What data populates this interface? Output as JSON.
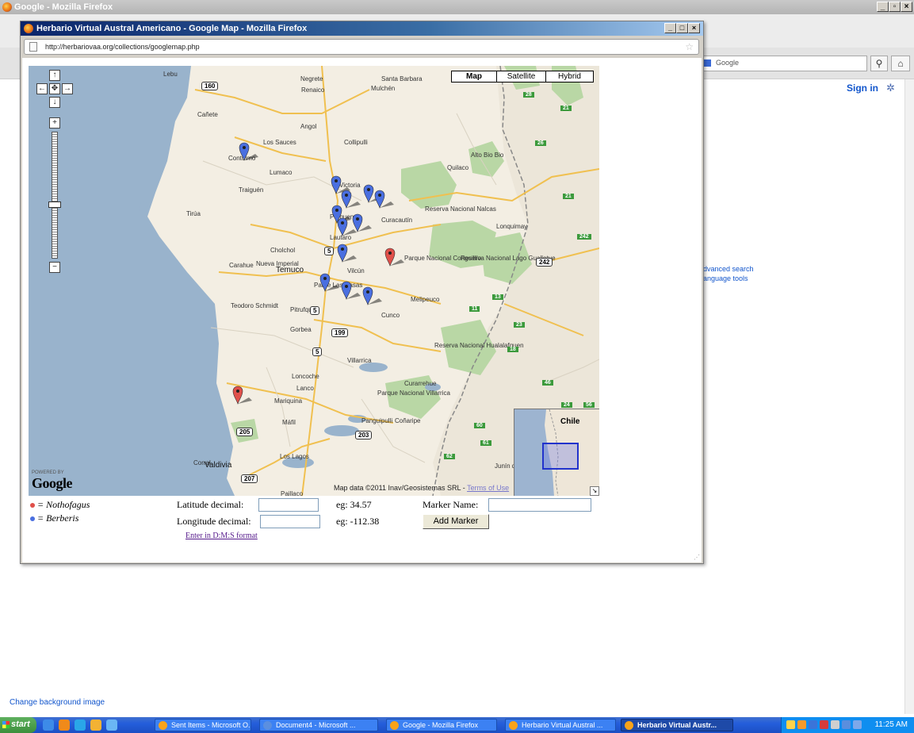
{
  "background_window": {
    "title": "Google - Mozilla Firefox",
    "search_placeholder": "Google",
    "sign_in": "Sign in",
    "links": [
      "dvanced search",
      "anguage tools"
    ],
    "change_background": "Change background image"
  },
  "popup": {
    "title": "Herbario Virtual Austral Americano - Google Map - Mozilla Firefox",
    "url": "http://herbariovaa.org/collections/googlemap.php"
  },
  "map": {
    "map_types": [
      "Map",
      "Satellite",
      "Hybrid"
    ],
    "selected_type": "Map",
    "powered_by": "POWERED BY",
    "google_logo": "Google",
    "attribution": "Map data ©2011 Inav/Geosistemas SRL -",
    "terms_link": "Terms of Use",
    "overview_label": "Chile",
    "place_labels": [
      {
        "text": "Lebu",
        "cls": "lbl"
      },
      {
        "text": "Negrete",
        "cls": "lbl"
      },
      {
        "text": "Renaico",
        "cls": "lbl"
      },
      {
        "text": "Santa Barbara",
        "cls": "lbl"
      },
      {
        "text": "Mulchén",
        "cls": "lbl"
      },
      {
        "text": "Cañete",
        "cls": "lbl"
      },
      {
        "text": "Angol",
        "cls": "lbl"
      },
      {
        "text": "Los Sauces",
        "cls": "lbl"
      },
      {
        "text": "Collipulli",
        "cls": "lbl"
      },
      {
        "text": "Contulmo",
        "cls": "lbl"
      },
      {
        "text": "Alto Bio Bio",
        "cls": "lbl"
      },
      {
        "text": "Lumaco",
        "cls": "lbl"
      },
      {
        "text": "Quilaco",
        "cls": "lbl"
      },
      {
        "text": "Traiguén",
        "cls": "lbl"
      },
      {
        "text": "Victoria",
        "cls": "lbl"
      },
      {
        "text": "Tirúa",
        "cls": "lbl"
      },
      {
        "text": "Reserva Nacional Nalcas",
        "cls": "lbl"
      },
      {
        "text": "Curacautín",
        "cls": "lbl"
      },
      {
        "text": "Perquenco",
        "cls": "lbl"
      },
      {
        "text": "Lonquimay",
        "cls": "lbl"
      },
      {
        "text": "Lautaro",
        "cls": "lbl"
      },
      {
        "text": "Cholchol",
        "cls": "lbl"
      },
      {
        "text": "Parque Nacional Conguillío",
        "cls": "lbl"
      },
      {
        "text": "Reserva Nacional Lago Gualletue",
        "cls": "lbl"
      },
      {
        "text": "Carahue",
        "cls": "lbl"
      },
      {
        "text": "Nueva Imperial",
        "cls": "lbl"
      },
      {
        "text": "Temuco",
        "cls": "lbl city"
      },
      {
        "text": "Vilcún",
        "cls": "lbl"
      },
      {
        "text": "Padre Las Casas",
        "cls": "lbl"
      },
      {
        "text": "Melipeuco",
        "cls": "lbl"
      },
      {
        "text": "Teodoro Schmidt",
        "cls": "lbl"
      },
      {
        "text": "Pitrufquén",
        "cls": "lbl"
      },
      {
        "text": "Cunco",
        "cls": "lbl"
      },
      {
        "text": "Gorbea",
        "cls": "lbl"
      },
      {
        "text": "Reserva Nacional Hualalafquen",
        "cls": "lbl"
      },
      {
        "text": "Villarrica",
        "cls": "lbl"
      },
      {
        "text": "Loncoche",
        "cls": "lbl"
      },
      {
        "text": "Lanco",
        "cls": "lbl"
      },
      {
        "text": "Curarrehue",
        "cls": "lbl"
      },
      {
        "text": "Mariquina",
        "cls": "lbl"
      },
      {
        "text": "Parque Nacional Villarrica",
        "cls": "lbl"
      },
      {
        "text": "Máfil",
        "cls": "lbl"
      },
      {
        "text": "Panguipulli",
        "cls": "lbl"
      },
      {
        "text": "Coñaripe",
        "cls": "lbl"
      },
      {
        "text": "Los Lagos",
        "cls": "lbl"
      },
      {
        "text": "Corral",
        "cls": "lbl"
      },
      {
        "text": "Valdivia",
        "cls": "lbl city"
      },
      {
        "text": "Paillaco",
        "cls": "lbl"
      },
      {
        "text": "Junín de Los A",
        "cls": "lbl"
      }
    ],
    "route_shields": [
      "160",
      "5",
      "5",
      "199",
      "5",
      "205",
      "203",
      "207",
      "242"
    ],
    "green_shields": [
      "28",
      "21",
      "26",
      "21",
      "242",
      "13",
      "11",
      "23",
      "18",
      "46",
      "24",
      "56",
      "60",
      "61",
      "62"
    ],
    "markers": [
      {
        "species": "Berberis",
        "color": "#4a6fe0"
      },
      {
        "species": "Berberis",
        "color": "#4a6fe0"
      },
      {
        "species": "Berberis",
        "color": "#4a6fe0"
      },
      {
        "species": "Berberis",
        "color": "#4a6fe0"
      },
      {
        "species": "Berberis",
        "color": "#4a6fe0"
      },
      {
        "species": "Berberis",
        "color": "#4a6fe0"
      },
      {
        "species": "Berberis",
        "color": "#4a6fe0"
      },
      {
        "species": "Berberis",
        "color": "#4a6fe0"
      },
      {
        "species": "Berberis",
        "color": "#4a6fe0"
      },
      {
        "species": "Berberis",
        "color": "#4a6fe0"
      },
      {
        "species": "Berberis",
        "color": "#4a6fe0"
      },
      {
        "species": "Berberis",
        "color": "#4a6fe0"
      },
      {
        "species": "Nothofagus",
        "color": "#e0504a"
      },
      {
        "species": "Nothofagus",
        "color": "#e0504a"
      }
    ]
  },
  "legend": [
    {
      "symbol": "= ",
      "name": "Nothofagus",
      "color": "#e0504a"
    },
    {
      "symbol": "= ",
      "name": "Berberis",
      "color": "#4a6fe0"
    }
  ],
  "form": {
    "latitude_label": "Latitude decimal:",
    "latitude_value": "",
    "latitude_example": "eg: 34.57",
    "longitude_label": "Longitude decimal:",
    "longitude_value": "",
    "longitude_example": "eg: -112.38",
    "marker_name_label": "Marker Name:",
    "marker_name_value": "",
    "add_marker_button": "Add Marker",
    "dms_link": "Enter in D:M:S format"
  },
  "taskbar": {
    "start": "start",
    "tasks": [
      {
        "label": "Sent Items - Microsoft O...",
        "active": false
      },
      {
        "label": "Document4 - Microsoft ...",
        "active": false
      },
      {
        "label": "Google - Mozilla Firefox",
        "active": false
      },
      {
        "label": "Herbario Virtual Austral ...",
        "active": false
      },
      {
        "label": "Herbario Virtual Austr...",
        "active": true
      }
    ],
    "clock": "11:25 AM"
  }
}
